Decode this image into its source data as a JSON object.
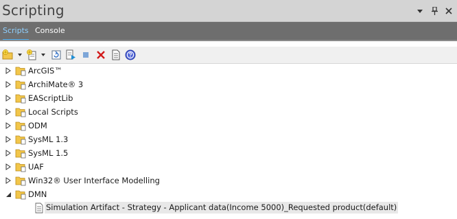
{
  "window": {
    "title": "Scripting",
    "controls": [
      {
        "name": "dropdown",
        "glyph": "▾"
      },
      {
        "name": "pin",
        "glyph": "⊥"
      },
      {
        "name": "close",
        "glyph": "×"
      }
    ]
  },
  "tabs": [
    {
      "label": "Scripts",
      "active": true
    },
    {
      "label": "Console",
      "active": false
    }
  ],
  "toolbar": {
    "buttons": [
      {
        "name": "new-folder-icon"
      },
      {
        "name": "new-script-icon"
      },
      {
        "name": "refresh-icon"
      },
      {
        "name": "run-script-icon"
      },
      {
        "name": "stop-script-icon"
      },
      {
        "name": "delete-icon"
      },
      {
        "name": "properties-icon"
      },
      {
        "name": "help-icon"
      }
    ]
  },
  "tree": {
    "groups": [
      {
        "label": "ArcGIS™",
        "expanded": false
      },
      {
        "label": "ArchiMate® 3",
        "expanded": false
      },
      {
        "label": "EAScriptLib",
        "expanded": false
      },
      {
        "label": "Local Scripts",
        "expanded": false
      },
      {
        "label": "ODM",
        "expanded": false
      },
      {
        "label": "SysML 1.3",
        "expanded": false
      },
      {
        "label": "SysML 1.5",
        "expanded": false
      },
      {
        "label": "UAF",
        "expanded": false
      },
      {
        "label": "Win32® User Interface Modelling",
        "expanded": false
      },
      {
        "label": "DMN",
        "expanded": true,
        "children": [
          {
            "label": "Simulation Artifact - Strategy - Applicant data(Income 5000)_Requested product(default)",
            "selected": true
          }
        ]
      }
    ]
  },
  "colors": {
    "title_bg": "#d4d4d4",
    "tab_bg": "#6e6e6e",
    "active_tab_text": "#8fd0ff",
    "folder": "#f2c64a",
    "selection": "#e8e8e8"
  }
}
